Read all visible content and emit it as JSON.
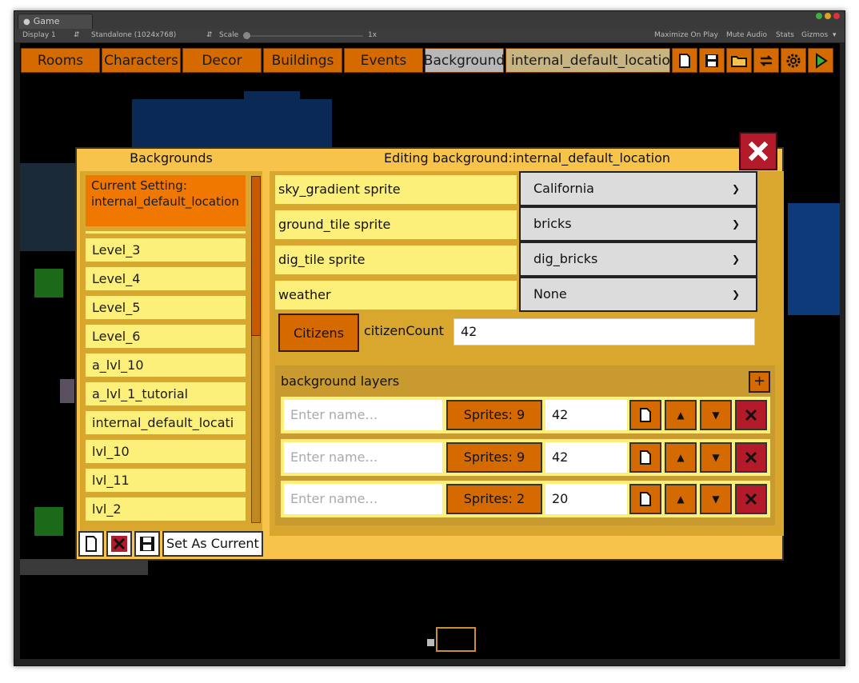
{
  "window": {
    "tab_title": "Game",
    "display": "Display 1",
    "resolution": "Standalone (1024x768)",
    "scale_label": "Scale",
    "scale_value": "1x",
    "maximize_on_play": "Maximize On Play",
    "mute_audio": "Mute Audio",
    "stats": "Stats",
    "gizmos": "Gizmos",
    "traffic_colors": [
      "#3cb043",
      "#e0a020",
      "#d8333a"
    ]
  },
  "topbar": {
    "tabs": [
      "Rooms",
      "Characters",
      "Decor",
      "Buildings",
      "Events",
      "Background"
    ],
    "selected_tab": "Background",
    "location": "internal_default_locatio",
    "icons": [
      "new-file-icon",
      "save-icon",
      "open-folder-icon",
      "swap-icon",
      "gear-icon",
      "play-icon"
    ]
  },
  "panel": {
    "left_title": "Backgrounds",
    "right_title": "Editing background:internal_default_location",
    "current_setting": "Current Setting: internal_default_location",
    "backgrounds": [
      "Level_3",
      "Level_4",
      "Level_5",
      "Level_6",
      "a_lvl_10",
      "a_lvl_1_tutorial",
      "internal_default_locati",
      "lvl_10",
      "lvl_11",
      "lvl_2"
    ],
    "set_as_current": "Set As Current",
    "properties": [
      {
        "label": "sky_gradient sprite",
        "value": "California"
      },
      {
        "label": "ground_tile sprite",
        "value": "bricks"
      },
      {
        "label": "dig_tile sprite",
        "value": "dig_bricks"
      },
      {
        "label": "weather",
        "value": "None"
      }
    ],
    "citizens_button": "Citizens",
    "citizen_count_label": "citizenCount",
    "citizen_count_value": "42",
    "layers_title": "background layers",
    "add_layer": "+",
    "layers": [
      {
        "placeholder": "Enter name…",
        "sprites": "Sprites: 9",
        "value": "42"
      },
      {
        "placeholder": "Enter name…",
        "sprites": "Sprites: 9",
        "value": "42"
      },
      {
        "placeholder": "Enter name…",
        "sprites": "Sprites: 2",
        "value": "20"
      }
    ]
  },
  "colors": {
    "accent_orange": "#d46a00",
    "panel_gold": "#f7c34a",
    "list_yellow": "#fdf07a",
    "delete_red": "#b31a2a"
  }
}
